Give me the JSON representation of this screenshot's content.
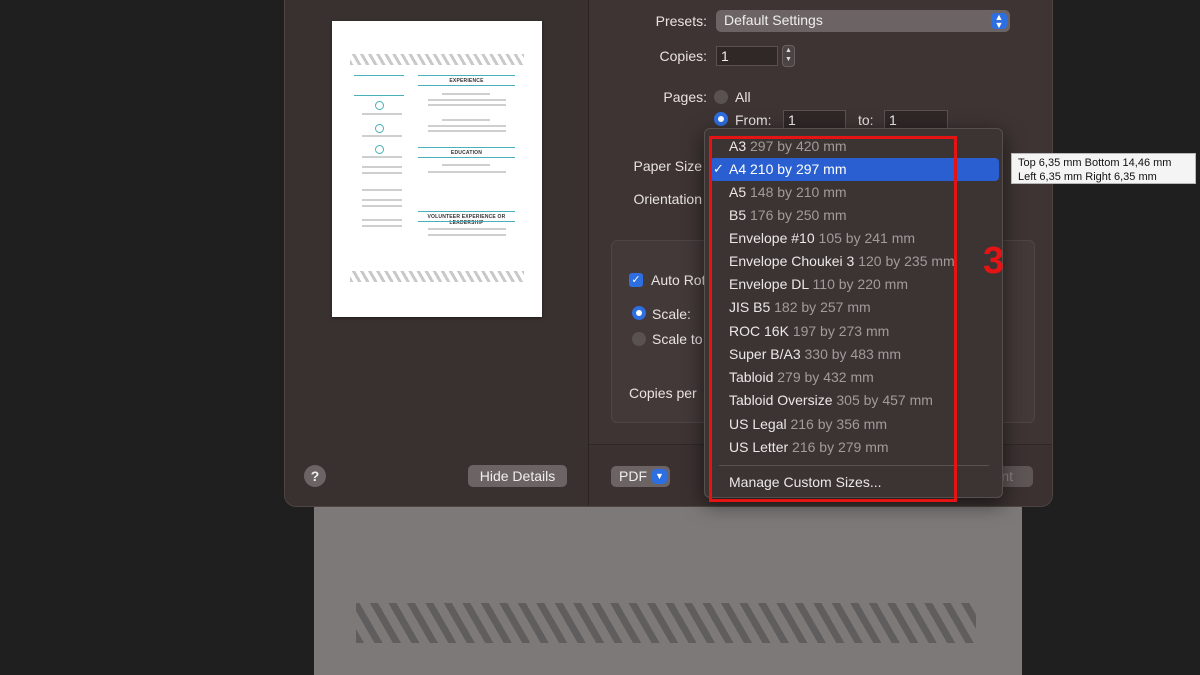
{
  "print_dialog": {
    "presets": {
      "label": "Presets:",
      "value": "Default Settings"
    },
    "copies": {
      "label": "Copies:",
      "value": "1"
    },
    "pages": {
      "label": "Pages:",
      "all_label": "All",
      "from_label": "From:",
      "from_value": "1",
      "to_label": "to:",
      "to_value": "1"
    },
    "paper_size": {
      "label": "Paper Size"
    },
    "orientation": {
      "label": "Orientation"
    },
    "options": {
      "auto_rotate_label": "Auto Rot",
      "scale_label": "Scale:",
      "scale_to_label": "Scale to",
      "copies_per_label": "Copies per"
    },
    "help_label": "?",
    "hide_details_label": "Hide Details",
    "pdf_label": "PDF",
    "print_label": "nt"
  },
  "preview": {
    "headings": [
      "EXPERIENCE",
      "EDUCATION",
      "VOLUNTEER EXPERIENCE OR LEADERSHIP"
    ]
  },
  "paper_size_menu": {
    "items": [
      {
        "name": "A3",
        "dims": "297 by 420 mm"
      },
      {
        "name": "A4 210 by 297 mm",
        "dims": "",
        "selected": true
      },
      {
        "name": "A5",
        "dims": "148 by 210 mm"
      },
      {
        "name": "B5",
        "dims": "176 by 250 mm"
      },
      {
        "name": "Envelope #10",
        "dims": "105 by 241 mm"
      },
      {
        "name": "Envelope Choukei 3",
        "dims": "120 by 235 mm"
      },
      {
        "name": "Envelope DL",
        "dims": "110 by 220 mm"
      },
      {
        "name": "JIS B5",
        "dims": "182 by 257 mm"
      },
      {
        "name": "ROC 16K",
        "dims": "197 by 273 mm"
      },
      {
        "name": "Super B/A3",
        "dims": "330 by 483 mm"
      },
      {
        "name": "Tabloid",
        "dims": "279 by 432 mm"
      },
      {
        "name": "Tabloid Oversize",
        "dims": "305 by 457 mm"
      },
      {
        "name": "US Legal",
        "dims": "216 by 356 mm"
      },
      {
        "name": "US Letter",
        "dims": "216 by 279 mm"
      }
    ],
    "check_mark": "✓",
    "manage_label": "Manage Custom Sizes..."
  },
  "tooltip": {
    "line1": "Top 6,35 mm Bottom 14,46 mm",
    "line2": "Left 6,35 mm Right 6,35 mm"
  },
  "annotation": {
    "number": "3",
    "color": "#e51414"
  },
  "colors": {
    "accent": "#2d6ee0",
    "selected_row": "#2a5fd1",
    "dialog_bg": "#3d3433"
  }
}
